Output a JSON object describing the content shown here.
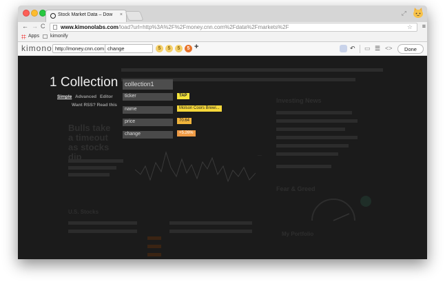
{
  "browser": {
    "tab_title": "Stock Market Data – Dow",
    "tab_close": "×",
    "url_domain": "www.kimonolabs.com",
    "url_path": "/load?url=http%3A%2F%2Fmoney.cnn.com%2Fdata%2Fmarkets%2F",
    "bookmarks": [
      "Apps",
      "kimonify"
    ],
    "icons": [
      "back-icon",
      "forward-icon",
      "reload-icon",
      "star-icon",
      "menu-icon"
    ]
  },
  "kimono": {
    "logo": "kimono",
    "url_value": "http://money.cnn.com",
    "collection_field": "change",
    "property_counts": [
      "5",
      "5",
      "5",
      "5"
    ],
    "add_label": "+",
    "done_label": "Done"
  },
  "panel": {
    "heading": "1 Collection",
    "modes": [
      "Simple",
      "Advanced",
      "Editor"
    ],
    "rss_link": "Want RSS? Read this",
    "collection_name": "collection1",
    "properties": [
      {
        "name": "ticker",
        "value": "TAP",
        "color": "#f6e53c"
      },
      {
        "name": "name",
        "value": "Molson Coors Brewi...",
        "color": "#f6d83a"
      },
      {
        "name": "price",
        "value": "70.64",
        "color": "#f1b43c"
      },
      {
        "name": "change",
        "value": "+5.26%",
        "color": "#ef9b45"
      }
    ]
  },
  "background_page": {
    "headline": "Bulls take a timeout as stocks dip",
    "investing_news": "Investing News",
    "fear_greed": "Fear & Greed",
    "us_stocks": "U.S. Stocks",
    "portfolio": "My Portfolio"
  }
}
